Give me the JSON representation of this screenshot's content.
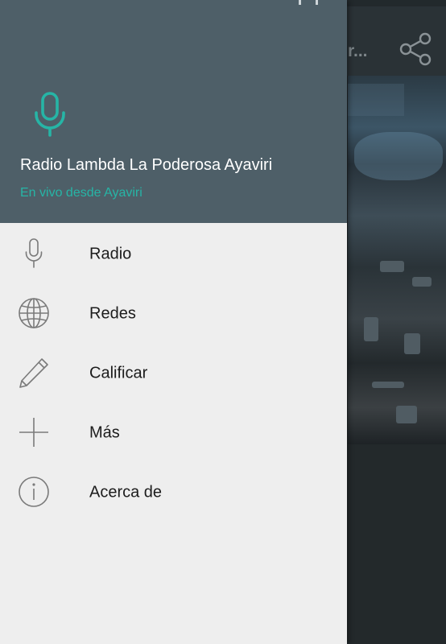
{
  "colors": {
    "header_bg": "#4e5f68",
    "accent": "#26b5a6",
    "drawer_bg": "#eeeeee",
    "icon": "#7a7a7a"
  },
  "background_app": {
    "toolbar_title": "r...",
    "share_icon": "share-icon"
  },
  "drawer": {
    "header": {
      "icon": "microphone-icon",
      "title": "Radio Lambda La Poderosa Ayaviri",
      "subtitle": "En vivo desde Ayaviri"
    },
    "menu": [
      {
        "icon": "microphone-icon",
        "label": "Radio"
      },
      {
        "icon": "globe-icon",
        "label": "Redes"
      },
      {
        "icon": "pencil-icon",
        "label": "Calificar"
      },
      {
        "icon": "plus-icon",
        "label": "Más"
      },
      {
        "icon": "info-icon",
        "label": "Acerca de"
      }
    ]
  }
}
